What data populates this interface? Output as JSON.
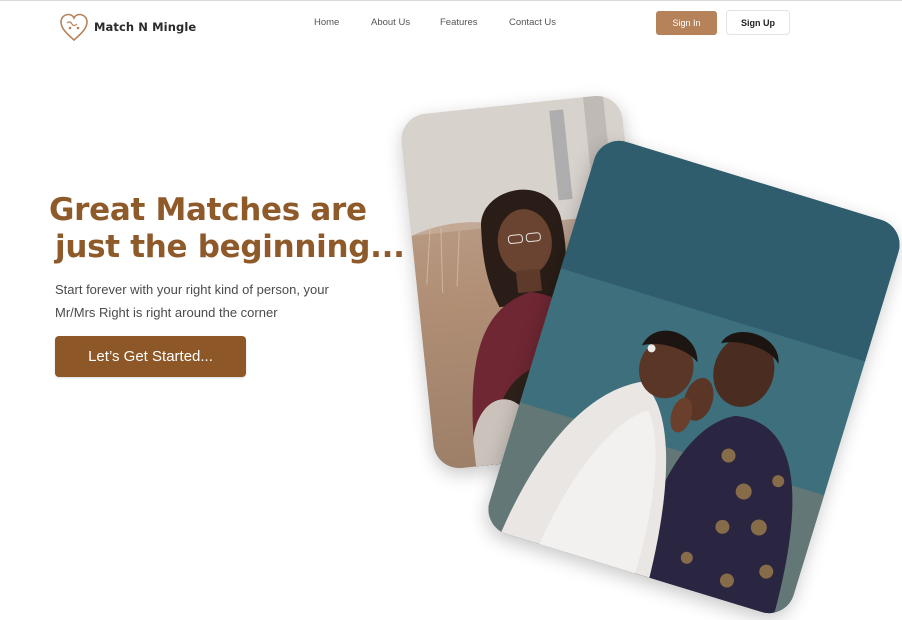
{
  "brand": {
    "name": "Match N Mingle"
  },
  "nav": {
    "links": [
      {
        "label": "Home"
      },
      {
        "label": "About Us"
      },
      {
        "label": "Features"
      },
      {
        "label": "Contact Us"
      }
    ],
    "sign_in_label": "Sign In",
    "sign_up_label": "Sign Up"
  },
  "hero": {
    "title_line1": "Great Matches are",
    "title_line2": "just the beginning...",
    "subtitle_line1": "Start forever with your right kind of person, your",
    "subtitle_line2": "Mr/Mrs Right is right around the corner",
    "cta_label": "Let’s Get Started..."
  },
  "photos": [
    {
      "icon": "portrait-woman-glasses-photo"
    },
    {
      "icon": "wedding-couple-embrace-photo"
    }
  ],
  "colors": {
    "brand_brown": "#8f5a2a",
    "sign_in_bg": "#b5825a",
    "cta_bg": "#8d5728"
  }
}
